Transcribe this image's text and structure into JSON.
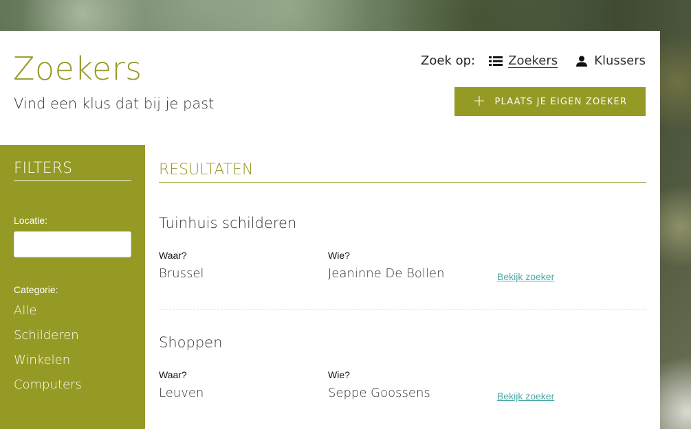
{
  "header": {
    "title": "Zoekers",
    "subtitle": "Vind een klus dat bij je past",
    "search_by_label": "Zoek op:",
    "search_by_options": [
      {
        "label": "Zoekers",
        "icon": "list-icon",
        "active": true
      },
      {
        "label": "Klussers",
        "icon": "user-icon",
        "active": false
      }
    ],
    "add_button_label": "PLAATS JE EIGEN ZOEKER"
  },
  "filters": {
    "title": "FILTERS",
    "location_label": "Locatie:",
    "location_value": "",
    "category_label": "Categorie:",
    "categories": [
      "Alle",
      "Schilderen",
      "Winkelen",
      "Computers"
    ]
  },
  "results": {
    "title": "RESULTATEN",
    "where_label": "Waar?",
    "who_label": "Wie?",
    "link_label": "Bekijk zoeker",
    "items": [
      {
        "title": "Tuinhuis schilderen",
        "where": "Brussel",
        "who": "Jeaninne De Bollen"
      },
      {
        "title": "Shoppen",
        "where": "Leuven",
        "who": "Seppe Goossens"
      }
    ]
  },
  "colors": {
    "accent": "#959a24",
    "link": "#4aa9a6"
  }
}
